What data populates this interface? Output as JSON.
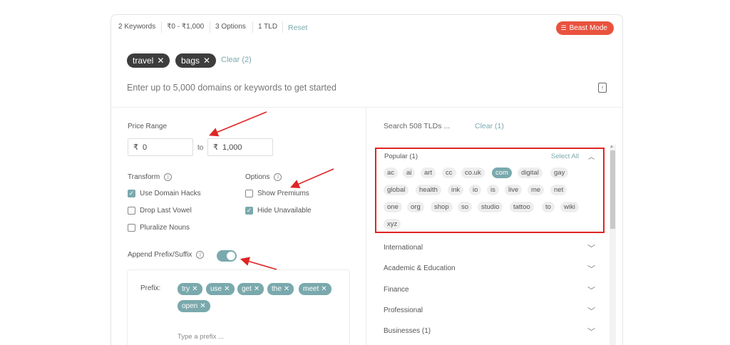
{
  "summary": {
    "keywords": "2 Keywords",
    "price": "₹0 - ₹1,000",
    "options": "3 Options",
    "tld": "1 TLD",
    "reset": "Reset",
    "beast_mode": "Beast Mode"
  },
  "keywords": [
    {
      "label": "travel"
    },
    {
      "label": "bags"
    }
  ],
  "clear_keywords": "Clear (2)",
  "domain_input_placeholder": "Enter up to 5,000 domains or keywords to get started",
  "price_range": {
    "label": "Price Range",
    "currency": "₹",
    "min": "0",
    "to": "to",
    "max": "1,000"
  },
  "transform": {
    "label": "Transform",
    "items": [
      {
        "label": "Use Domain Hacks",
        "checked": true
      },
      {
        "label": "Drop Last Vowel",
        "checked": false
      },
      {
        "label": "Pluralize Nouns",
        "checked": false
      }
    ]
  },
  "options": {
    "label": "Options",
    "items": [
      {
        "label": "Show Premiums",
        "checked": false
      },
      {
        "label": "Hide Unavailable",
        "checked": true
      }
    ]
  },
  "append": {
    "label": "Append Prefix/Suffix",
    "enabled": true,
    "prefix_label": "Prefix:",
    "prefixes": [
      "try",
      "use",
      "get",
      "the",
      "meet",
      "open"
    ],
    "prefix_placeholder": "Type a prefix ..."
  },
  "tld_search": {
    "placeholder": "Search 508 TLDs ...",
    "clear": "Clear (1)"
  },
  "popular": {
    "title": "Popular (1)",
    "select_all": "Select All",
    "tlds": [
      "ac",
      "ai",
      "art",
      "cc",
      "co.uk",
      "com",
      "digital",
      "gay",
      "global",
      "health",
      "ink",
      "io",
      "is",
      "live",
      "me",
      "net",
      "one",
      "org",
      "shop",
      "so",
      "studio",
      "tattoo",
      "to",
      "wiki",
      "xyz"
    ],
    "selected": "com"
  },
  "categories": [
    "International",
    "Academic & Education",
    "Finance",
    "Professional",
    "Businesses (1)"
  ],
  "colors": {
    "accent": "#7aa9ad",
    "beast": "#e9523e",
    "chip_dark": "#3d3d3d",
    "highlight_box": "#e02424"
  }
}
